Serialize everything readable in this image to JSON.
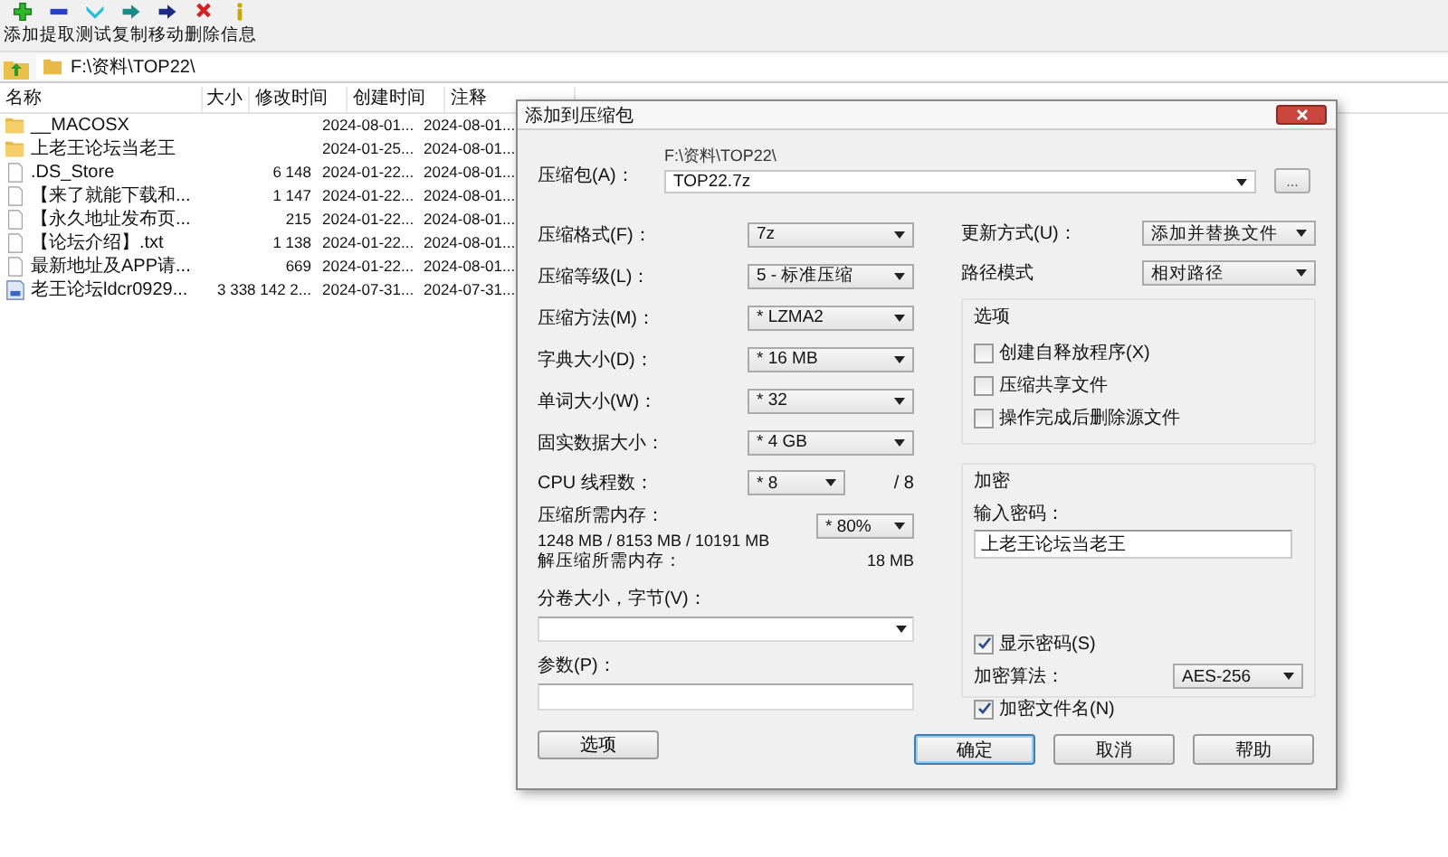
{
  "toolbar": [
    {
      "kind": "add",
      "label": "添加"
    },
    {
      "kind": "extract",
      "label": "提取"
    },
    {
      "kind": "test",
      "label": "测试"
    },
    {
      "kind": "copy",
      "label": "复制"
    },
    {
      "kind": "move",
      "label": "移动"
    },
    {
      "kind": "delete",
      "label": "删除"
    },
    {
      "kind": "info",
      "label": "信息"
    }
  ],
  "address": "F:\\资料\\TOP22\\",
  "columns": [
    "名称",
    "大小",
    "修改时间",
    "创建时间",
    "注释"
  ],
  "files": [
    {
      "kind": "folder",
      "name": "__MACOSX",
      "modified": "2024-08-01...",
      "created": "2024-08-01..."
    },
    {
      "kind": "folder",
      "name": "上老王论坛当老王",
      "modified": "2024-01-25...",
      "created": "2024-08-01..."
    },
    {
      "kind": "file",
      "name": ".DS_Store",
      "size": "6 148",
      "modified": "2024-01-22...",
      "created": "2024-08-01..."
    },
    {
      "kind": "file",
      "name": "【来了就能下载和...",
      "size": "1 147",
      "modified": "2024-01-22...",
      "created": "2024-08-01..."
    },
    {
      "kind": "file",
      "name": "【永久地址发布页...",
      "size": "215",
      "modified": "2024-01-22...",
      "created": "2024-08-01..."
    },
    {
      "kind": "file",
      "name": "【论坛介绍】.txt",
      "size": "1 138",
      "modified": "2024-01-22...",
      "created": "2024-08-01..."
    },
    {
      "kind": "file",
      "name": "最新地址及APP请...",
      "size": "669",
      "modified": "2024-01-22...",
      "created": "2024-08-01..."
    },
    {
      "kind": "archive",
      "name": "老王论坛ldcr0929...",
      "size": "3 338 142 2...",
      "modified": "2024-07-31...",
      "created": "2024-07-31..."
    }
  ],
  "dialog": {
    "title": "添加到压缩包",
    "archive": {
      "label": "压缩包(A)：",
      "path": "F:\\资料\\TOP22\\",
      "value": "TOP22.7z",
      "browse": "..."
    },
    "combos": [
      {
        "label": "压缩格式(F)：",
        "value": "7z"
      },
      {
        "label": "压缩等级(L)：",
        "value": "5 - 标准压缩"
      },
      {
        "label": "压缩方法(M)：",
        "value": "* LZMA2"
      },
      {
        "label": "字典大小(D)：",
        "value": "* 16 MB"
      },
      {
        "label": "单词大小(W)：",
        "value": "* 32"
      },
      {
        "label": "固实数据大小：",
        "value": "* 4 GB"
      }
    ],
    "threads": {
      "label": "CPU 线程数：",
      "value": "* 8",
      "max": "/ 8"
    },
    "memory": {
      "label": "压缩所需内存：",
      "detail": "1248 MB / 8153 MB / 10191 MB",
      "value": "* 80%"
    },
    "decompress": {
      "label": "解压缩所需内存：",
      "value": "18 MB"
    },
    "split": {
      "label": "分卷大小，字节(V)："
    },
    "params": {
      "label": "参数(P)："
    },
    "options_button": "选项",
    "update": {
      "label": "更新方式(U)：",
      "value": "添加并替换文件"
    },
    "path_mode": {
      "label": "路径模式",
      "value": "相对路径"
    },
    "options": {
      "title": "选项",
      "checkboxes": [
        {
          "label": "创建自释放程序(X)",
          "checked": false
        },
        {
          "label": "压缩共享文件",
          "checked": false
        },
        {
          "label": "操作完成后删除源文件",
          "checked": false
        }
      ]
    },
    "encryption": {
      "title": "加密",
      "password_label": "输入密码：",
      "password": "上老王论坛当老王",
      "show_password": {
        "label": "显示密码(S)",
        "checked": true
      },
      "algorithm": {
        "label": "加密算法：",
        "value": "AES-256"
      },
      "encrypt_names": {
        "label": "加密文件名(N)",
        "checked": true
      }
    },
    "buttons": [
      {
        "label": "确定",
        "default": true
      },
      {
        "label": "取消",
        "default": false
      },
      {
        "label": "帮助",
        "default": false
      }
    ]
  }
}
